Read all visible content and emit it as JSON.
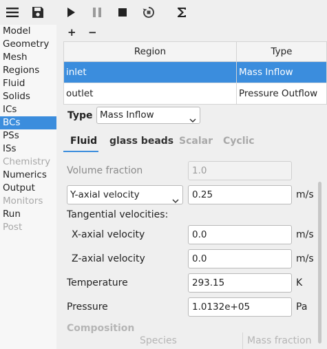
{
  "toolbar": {
    "icons": [
      "menu-icon",
      "save-icon",
      "play-icon",
      "pause-icon",
      "stop-icon",
      "reset-icon",
      "sum-icon"
    ]
  },
  "nav": {
    "items": [
      {
        "label": "Model",
        "state": "normal"
      },
      {
        "label": "Geometry",
        "state": "normal"
      },
      {
        "label": "Mesh",
        "state": "normal"
      },
      {
        "label": "Regions",
        "state": "normal"
      },
      {
        "label": "Fluid",
        "state": "normal"
      },
      {
        "label": "Solids",
        "state": "normal"
      },
      {
        "label": "ICs",
        "state": "normal"
      },
      {
        "label": "BCs",
        "state": "selected"
      },
      {
        "label": "PSs",
        "state": "normal"
      },
      {
        "label": "ISs",
        "state": "normal"
      },
      {
        "label": "Chemistry",
        "state": "disabled"
      },
      {
        "label": "Numerics",
        "state": "normal"
      },
      {
        "label": "Output",
        "state": "normal"
      },
      {
        "label": "Monitors",
        "state": "disabled"
      },
      {
        "label": "Run",
        "state": "normal"
      },
      {
        "label": "Post",
        "state": "disabled"
      }
    ]
  },
  "regions_table": {
    "add_label": "+",
    "remove_label": "−",
    "headers": [
      "Region",
      "Type"
    ],
    "rows": [
      {
        "region": "inlet",
        "type": "Mass Inflow",
        "selected": true
      },
      {
        "region": "outlet",
        "type": "Pressure Outflow",
        "selected": false
      }
    ]
  },
  "type_selector": {
    "label": "Type",
    "value": "Mass Inflow"
  },
  "tabs": [
    {
      "label": "Fluid",
      "state": "active"
    },
    {
      "label": "glass beads",
      "state": "normal"
    },
    {
      "label": "Scalar",
      "state": "disabled"
    },
    {
      "label": "Cyclic",
      "state": "disabled"
    }
  ],
  "form": {
    "volume_fraction": {
      "label": "Volume fraction",
      "value": "1.0"
    },
    "axial_velocity": {
      "selector": "Y-axial velocity",
      "value": "0.25",
      "unit": "m/s"
    },
    "tangential_header": "Tangential velocities:",
    "x_velocity": {
      "label": "X-axial velocity",
      "value": "0.0",
      "unit": "m/s"
    },
    "z_velocity": {
      "label": "Z-axial velocity",
      "value": "0.0",
      "unit": "m/s"
    },
    "temperature": {
      "label": "Temperature",
      "value": "293.15",
      "unit": "K"
    },
    "pressure": {
      "label": "Pressure",
      "value": "1.0132e+05",
      "unit": "Pa"
    },
    "composition_header": "Composition",
    "species_header": "Species",
    "mass_fraction_header": "Mass fraction"
  },
  "colors": {
    "accent": "#3b8ddd",
    "disabled_text": "#a8a8a8"
  }
}
